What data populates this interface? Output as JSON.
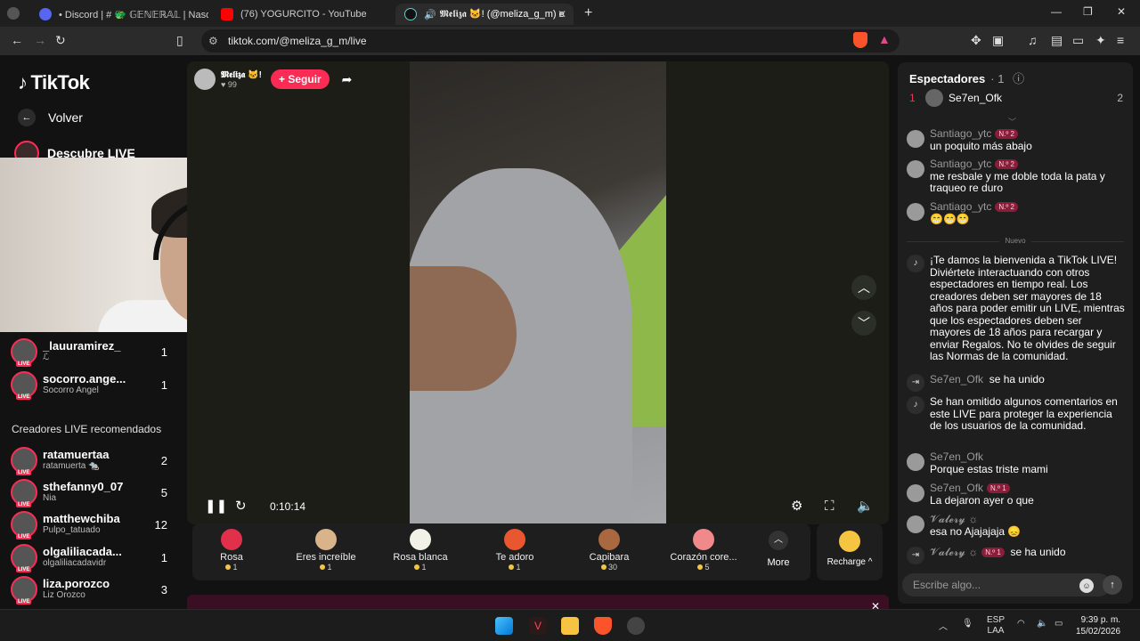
{
  "browser": {
    "tabs": [
      {
        "label": "• Discord | # 🐲 𝔾𝔼ℕ𝔼ℝ𝔸𝕃 | Nasdaq",
        "active": false
      },
      {
        "label": "(76) YOGURCITO - YouTube",
        "active": false
      },
      {
        "label": "𝕸𝖊𝖑𝖎𝖟𝖆 🐱! (@meliza_g_m) est",
        "active": true
      }
    ],
    "url": "tiktok.com/@meliza_g_m/live"
  },
  "sidebar": {
    "logo": "TikTok",
    "back_label": "Volver",
    "discover_label": "Descubre LIVE",
    "following": [
      {
        "name": "_lauuramirez_",
        "sub": "ℒ",
        "count": "1"
      },
      {
        "name": "socorro.ange...",
        "sub": "Socorro Angel",
        "count": "1"
      }
    ],
    "recommended_title": "Creadores LIVE recomendados",
    "recommended": [
      {
        "name": "ratamuertaa",
        "sub": "ratamuerta 🐀",
        "count": "2"
      },
      {
        "name": "sthefanny0_07",
        "sub": "Nia",
        "count": "5"
      },
      {
        "name": "matthewchiba",
        "sub": "Pulpo_tatuado",
        "count": "12"
      },
      {
        "name": "olgaliliacada...",
        "sub": "olgaliliacadavidr",
        "count": "1"
      },
      {
        "name": "liza.porozco",
        "sub": "Liz Orozco",
        "count": "3"
      }
    ]
  },
  "stream": {
    "host_name": "𝕸𝖊𝖑𝖎𝖟𝖆 🐱!",
    "host_likes": "♥ 99",
    "follow_label": "+ Seguir",
    "timer": "0:10:14"
  },
  "gifts": [
    {
      "name": "Rosa",
      "price": "1",
      "color": "#e0304a"
    },
    {
      "name": "Eres increíble",
      "price": "1",
      "color": "#d9b48a"
    },
    {
      "name": "Rosa blanca",
      "price": "1",
      "color": "#f1f1e8"
    },
    {
      "name": "Te adoro",
      "price": "1",
      "color": "#e8572f"
    },
    {
      "name": "Capibara",
      "price": "30",
      "color": "#a9683f"
    },
    {
      "name": "Corazón core...",
      "price": "5",
      "color": "#f08a8a"
    }
  ],
  "more_label": "More",
  "recharge_label": "Recharge ^",
  "chat": {
    "viewers_title": "Espectadores",
    "viewers_count": "· 1",
    "top_viewer": {
      "rank": "1",
      "name": "Se7en_Ofk",
      "value": "2"
    },
    "nuevo_label": "Nuevo",
    "input_placeholder": "Escribe algo...",
    "messages": [
      {
        "user": "Santiago_ytc",
        "badge": "N.º 2",
        "text": "un poquito más abajo"
      },
      {
        "user": "Santiago_ytc",
        "badge": "N.º 2",
        "text": "me resbale y me doble toda la pata y traqueo re duro"
      },
      {
        "user": "Santiago_ytc",
        "badge": "N.º 2",
        "text": "😁😁😁"
      },
      {
        "user": "",
        "badge": "",
        "text": "¡Te damos la bienvenida a TikTok LIVE! Diviértete interactuando con otros espectadores en tiempo real. Los creadores deben ser mayores de 18 años para poder emitir un LIVE, mientras que los espectadores deben ser mayores de 18 años para recargar y enviar Regalos. No te olvides de seguir las Normas de la comunidad."
      },
      {
        "user": "Se7en_Ofk",
        "badge": "",
        "text": "se ha unido"
      },
      {
        "user": "",
        "badge": "",
        "text": "Se han omitido algunos comentarios en este LIVE para proteger la experiencia de los usuarios de la comunidad."
      },
      {
        "user": "Se7en_Ofk",
        "badge": "",
        "text": "Porque estas triste mami"
      },
      {
        "user": "Se7en_Ofk",
        "badge": "N.º 1",
        "text": "La dejaron ayer o que"
      },
      {
        "user": "𝓥𝓪𝓵𝓮𝓻𝔂 ☼",
        "badge": "",
        "text": "esa no Ajajajaja 😞"
      },
      {
        "user": "𝓥𝓪𝓵𝓮𝓻𝔂 ☼",
        "badge": "N.º 1",
        "text": "se ha unido"
      }
    ]
  },
  "taskbar": {
    "lang": "ESP",
    "lang2": "LAA",
    "time": "9:39 p. m.",
    "date": "15/02/2026"
  },
  "colors": {
    "accent": "#fe2c55",
    "coin": "#f5c542"
  }
}
